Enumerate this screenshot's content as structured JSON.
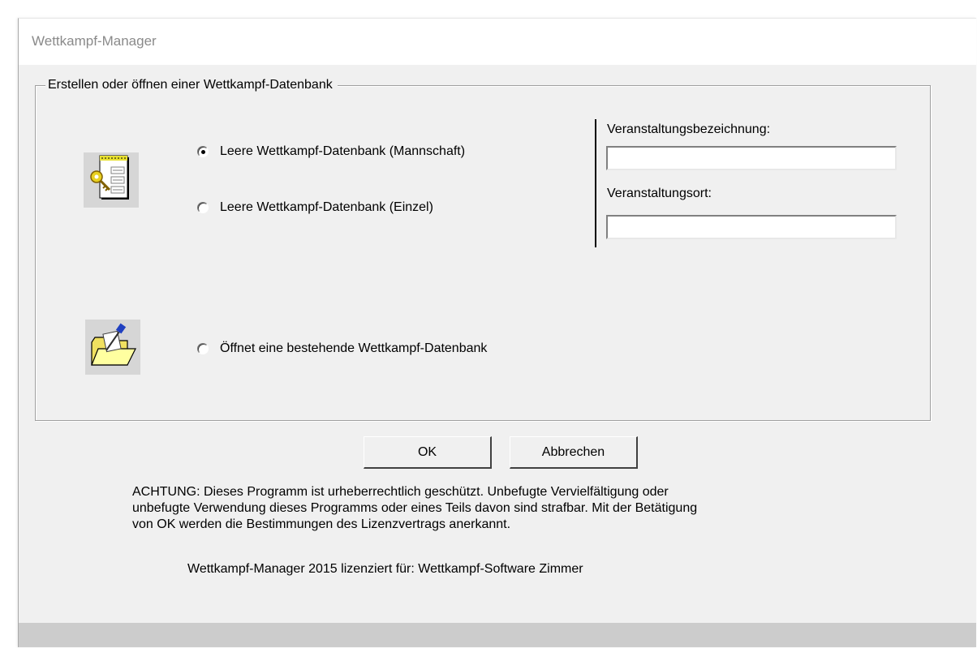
{
  "window": {
    "title": "Wettkampf-Manager"
  },
  "group": {
    "legend": "Erstellen oder öffnen einer Wettkampf-Datenbank",
    "options": [
      {
        "label": "Leere Wettkampf-Datenbank (Mannschaft)",
        "checked": true
      },
      {
        "label": "Leere Wettkampf-Datenbank (Einzel)",
        "checked": false
      },
      {
        "label": "Öffnet eine bestehende Wettkampf-Datenbank",
        "checked": false
      }
    ],
    "icons": [
      "new-database-icon",
      "open-folder-icon"
    ]
  },
  "fields": {
    "event_name_label": "Veranstaltungsbezeichnung:",
    "event_name_value": "",
    "event_location_label": "Veranstaltungsort:",
    "event_location_value": ""
  },
  "buttons": {
    "ok_label": "OK",
    "cancel_label": "Abbrechen"
  },
  "notice": {
    "lines": [
      "ACHTUNG: Dieses Programm ist urheberrechtlich geschützt. Unbefugte Vervielfältigung oder",
      "unbefugte Verwendung  dieses Programms oder eines Teils davon sind strafbar. Mit der Betätigung",
      "von OK werden die Bestimmungen des Lizenzvertrags anerkannt."
    ],
    "license": "Wettkampf-Manager 2015 lizenziert für: Wettkampf-Software Zimmer"
  }
}
